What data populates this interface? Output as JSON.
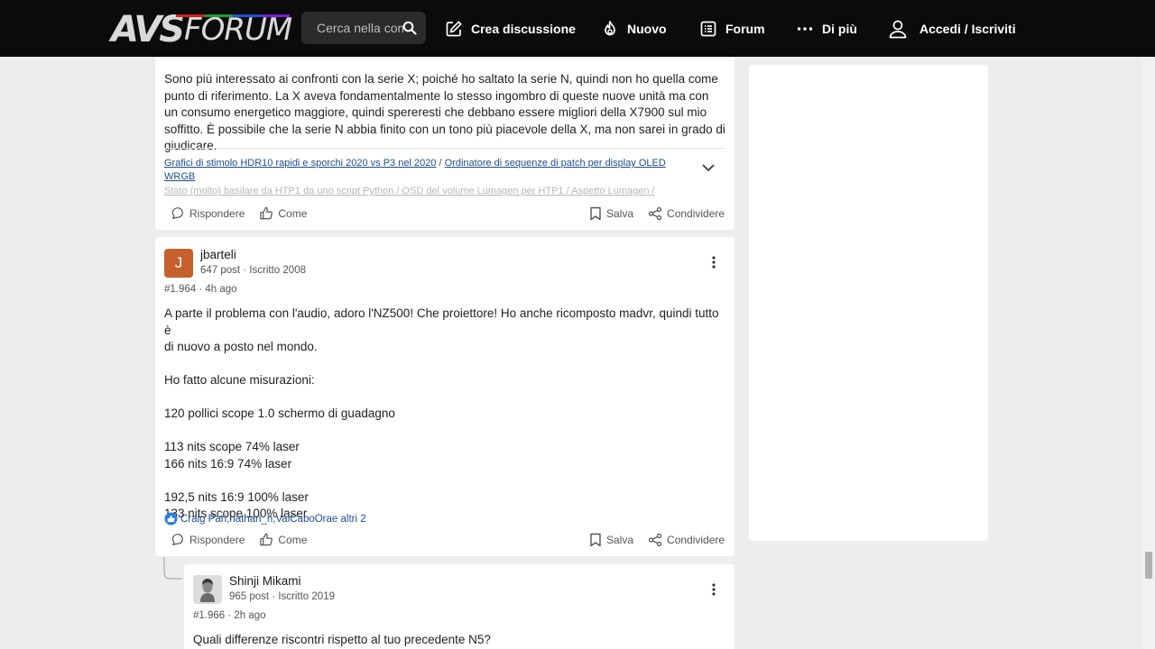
{
  "header": {
    "logo_avs": "AVS",
    "logo_forum": "FORUM",
    "logo_colors": [
      "#d11f2a",
      "#1f9a3a",
      "#1f4fd1",
      "#7a1fd1"
    ],
    "search_placeholder": "Cerca nella com",
    "nav": {
      "create": "Crea discussione",
      "new": "Nuovo",
      "forum": "Forum",
      "more": "Di più",
      "login": "Accedi / Iscriviti"
    }
  },
  "post1": {
    "body": "Sono più interessato ai confronti con la serie X; poiché ho saltato la serie N, quindi non ho quella come punto di riferimento. La X aveva fondamentalmente lo stesso ingombro di queste nuove unità ma con un consumo energetico maggiore, quindi spereresti che debbano essere migliori della X7900 sul mio soffitto. È possibile che la serie N abbia finito con un tono più piacevole della X, ma non sarei in grado di giudicare.",
    "signature": {
      "link1": "Grafici di stimolo HDR10 rapidi e sporchi 2020 vs P3 nel 2020",
      "separator": "/",
      "link2": "Ordinatore di sequenze di patch per display OLED WRGB",
      "faded": "Stato (molto) basilare da HTP1 da uno script Python / OSD del volume Lumagen per HTP1 / Aspetto Lumagen /"
    },
    "actions": {
      "reply": "Rispondere",
      "like": "Come",
      "save": "Salva",
      "share": "Condividere"
    }
  },
  "post2": {
    "avatar_letter": "J",
    "username": "jbarteli",
    "user_meta": "647 post · Iscritto 2008",
    "post_meta": "#1.964 · 4h ago",
    "lines": [
      "A parte il problema con l'audio, adoro l'NZ500! Che proiettore! Ho anche ricomposto madvr, quindi tutto è",
      "di nuovo a posto nel mondo.",
      "",
      "Ho fatto alcune misurazioni:",
      "",
      "120 pollici scope 1.0 schermo di guadagno",
      "",
      "113 nits scope 74% laser",
      "166 nits 16:9 74% laser",
      "",
      "192,5 nits 16:9 100% laser",
      "133 nits scope 100% laser"
    ],
    "likes": "Craig Pari,nathan_h,VaiCaboOrae altri 2",
    "actions": {
      "reply": "Rispondere",
      "like": "Come",
      "save": "Salva",
      "share": "Condividere"
    }
  },
  "post3": {
    "username": "Shinji Mikami",
    "user_meta": "965 post · Iscritto 2019",
    "post_meta": "#1.966 · 2h ago",
    "body": "Quali differenze riscontri rispetto al tuo precedente N5?"
  }
}
